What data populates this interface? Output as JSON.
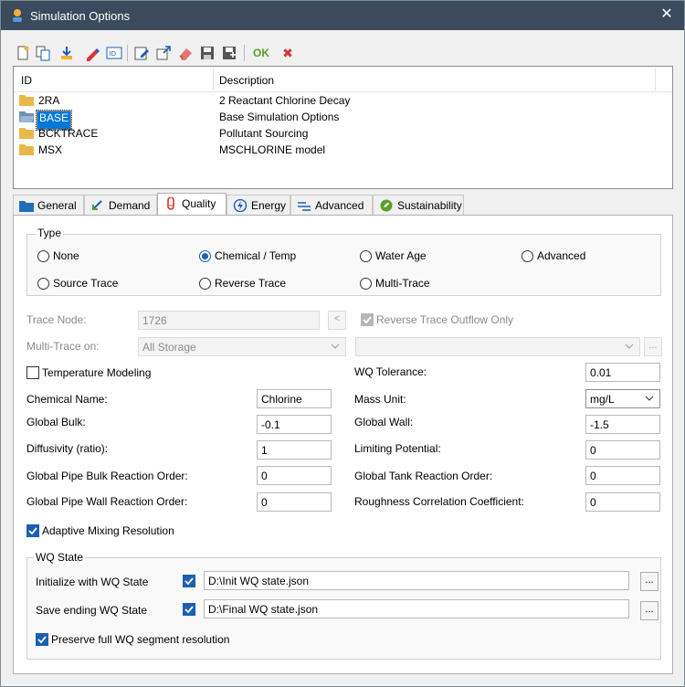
{
  "window": {
    "title": "Simulation Options",
    "close_glyph": "✕"
  },
  "toolbar": {
    "icons": [
      "new-icon",
      "duplicate-icon",
      "import-icon",
      "rename-icon",
      "id-card-icon",
      "edit-icon",
      "export-icon",
      "delete-icon",
      "save-icon",
      "save-all-icon"
    ],
    "ok_label": "OK",
    "cancel_glyph": "✖"
  },
  "list": {
    "headers": {
      "id": "ID",
      "description": "Description"
    },
    "rows": [
      {
        "id": "2RA",
        "description": "2 Reactant Chlorine Decay",
        "selected": false
      },
      {
        "id": "BASE",
        "description": "Base Simulation Options",
        "selected": true
      },
      {
        "id": "BCKTRACE",
        "description": "Pollutant Sourcing",
        "selected": false
      },
      {
        "id": "MSX",
        "description": "MSCHLORINE model",
        "selected": false
      }
    ]
  },
  "tabs": [
    {
      "label": "General",
      "icon": "folder-icon",
      "active": false
    },
    {
      "label": "Demand",
      "icon": "demand-icon",
      "active": false
    },
    {
      "label": "Quality",
      "icon": "quality-icon",
      "active": true
    },
    {
      "label": "Energy",
      "icon": "energy-icon",
      "active": false
    },
    {
      "label": "Advanced",
      "icon": "advanced-icon",
      "active": false
    },
    {
      "label": "Sustainability",
      "icon": "sustainability-icon",
      "active": false
    }
  ],
  "quality": {
    "type_group_label": "Type",
    "type_options": {
      "none": "None",
      "chemical_temp": "Chemical / Temp",
      "water_age": "Water Age",
      "advanced": "Advanced",
      "source_trace": "Source Trace",
      "reverse_trace": "Reverse Trace",
      "multi_trace": "Multi-Trace"
    },
    "type_selected": "Chemical / Temp",
    "trace_node_label": "Trace Node:",
    "trace_node_value": "1726",
    "trace_node_button": "<",
    "reverse_outflow_label": "Reverse Trace Outflow Only",
    "reverse_outflow_checked": true,
    "multi_trace_label": "Multi-Trace on:",
    "multi_trace_value": "All Storage",
    "multi_trace_second_value": "",
    "multi_trace_button": "...",
    "temperature_modeling_label": "Temperature Modeling",
    "temperature_modeling_checked": false,
    "wq_tolerance_label": "WQ Tolerance:",
    "wq_tolerance_value": "0.01",
    "chemical_name_label": "Chemical Name:",
    "chemical_name_value": "Chlorine",
    "mass_unit_label": "Mass Unit:",
    "mass_unit_value": "mg/L",
    "global_bulk_label": "Global Bulk:",
    "global_bulk_value": "-0.1",
    "global_wall_label": "Global Wall:",
    "global_wall_value": "-1.5",
    "diffusivity_label": "Diffusivity (ratio):",
    "diffusivity_value": "1",
    "limiting_potential_label": "Limiting Potential:",
    "limiting_potential_value": "0",
    "pipe_bulk_order_label": "Global Pipe Bulk Reaction Order:",
    "pipe_bulk_order_value": "0",
    "tank_order_label": "Global Tank Reaction Order:",
    "tank_order_value": "0",
    "pipe_wall_order_label": "Global Pipe Wall Reaction Order:",
    "pipe_wall_order_value": "0",
    "roughness_coeff_label": "Roughness Correlation Coefficient:",
    "roughness_coeff_value": "0",
    "adaptive_mixing_label": "Adaptive Mixing Resolution",
    "adaptive_mixing_checked": true,
    "wq_state": {
      "group_label": "WQ State",
      "init_label": "Initialize with WQ State",
      "init_checked": true,
      "init_path": "D:\\Init WQ state.json",
      "init_button": "...",
      "save_label": "Save ending WQ State",
      "save_checked": true,
      "save_path": "D:\\Final WQ state.json",
      "save_button": "...",
      "preserve_label": "Preserve full WQ segment resolution",
      "preserve_checked": true
    }
  },
  "colors": {
    "titlebar": "#3b4a5c",
    "accent": "#1a5fb4",
    "ok_green": "#5aa02c",
    "cancel_red": "#d9332c",
    "folder": "#e8b84a"
  }
}
